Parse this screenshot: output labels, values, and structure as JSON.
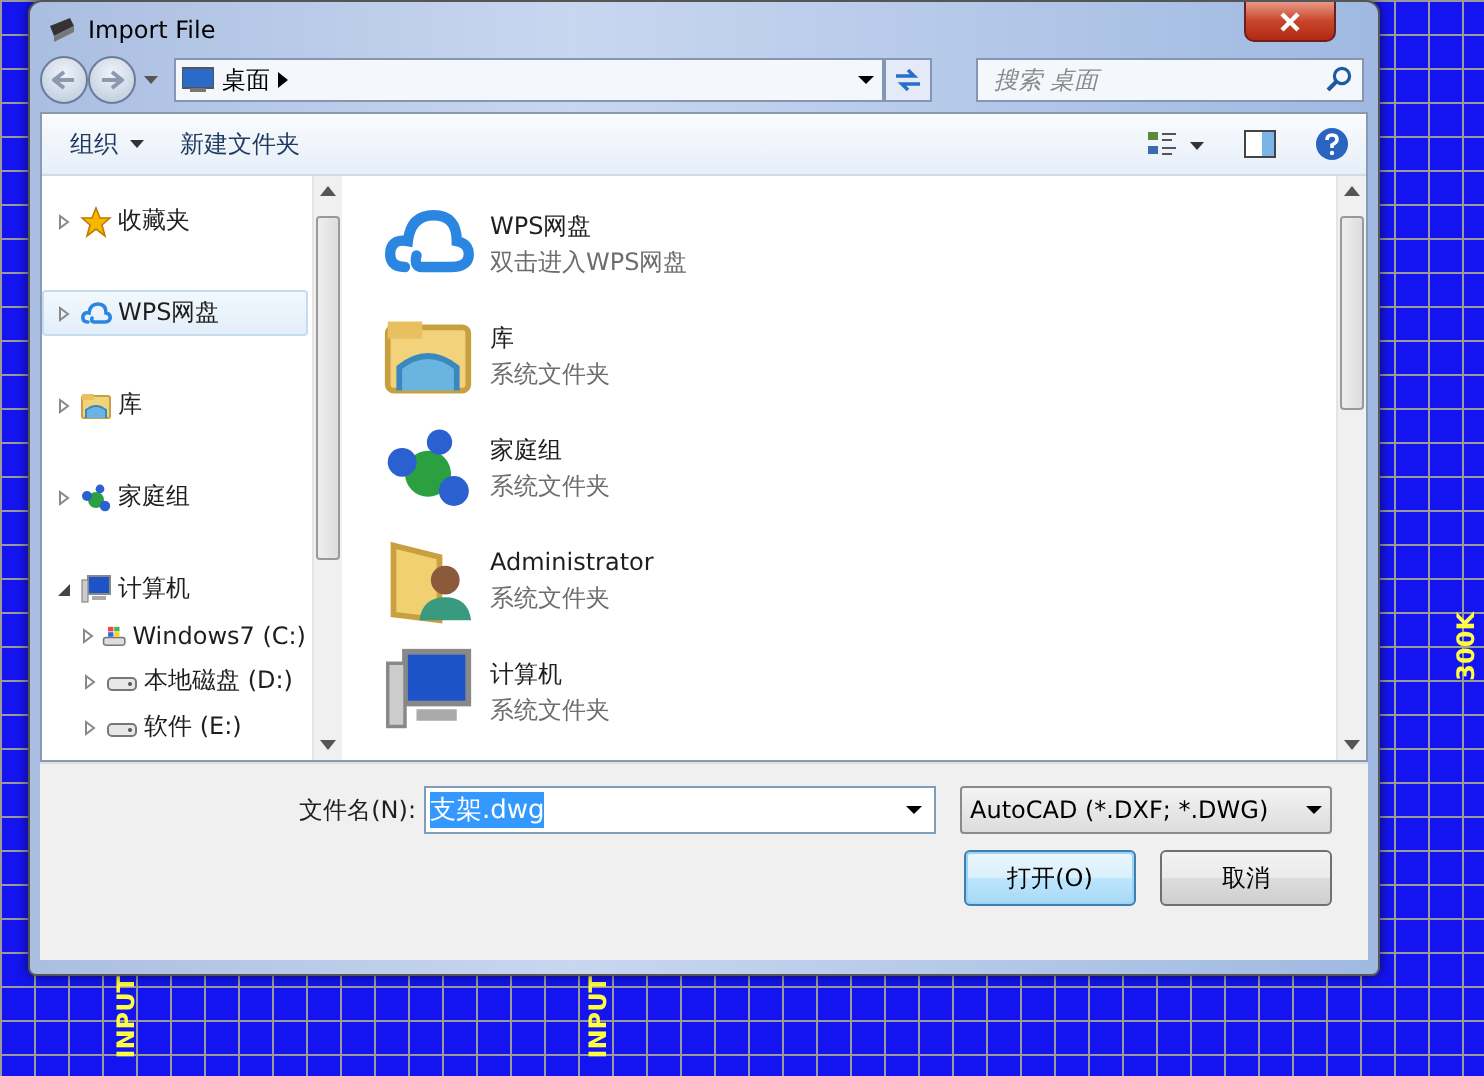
{
  "background": {
    "labels": [
      {
        "text": "INPUT"
      },
      {
        "text": "INPUT"
      },
      {
        "text": "300K"
      }
    ]
  },
  "window": {
    "title": "Import File"
  },
  "address": {
    "path": "桌面",
    "search_placeholder": "搜索 桌面"
  },
  "toolbar": {
    "organize": "组织",
    "new_folder": "新建文件夹"
  },
  "nav": [
    {
      "label": "收藏夹",
      "kind": "star",
      "selected": false,
      "expanded": false
    },
    {
      "label": "WPS网盘",
      "kind": "cloud",
      "selected": true,
      "expanded": false
    },
    {
      "label": "库",
      "kind": "library",
      "selected": false,
      "expanded": false
    },
    {
      "label": "家庭组",
      "kind": "homegroup",
      "selected": false,
      "expanded": false
    },
    {
      "label": "计算机",
      "kind": "computer",
      "selected": false,
      "expanded": true,
      "children": [
        {
          "label": "Windows7 (C:)",
          "kind": "system",
          "selected": false,
          "expanded": false
        },
        {
          "label": "本地磁盘 (D:)",
          "kind": "drive",
          "selected": false,
          "expanded": false
        },
        {
          "label": "软件 (E:)",
          "kind": "drive",
          "selected": false,
          "expanded": false
        }
      ]
    }
  ],
  "files": [
    {
      "name": "WPS网盘",
      "description": "双击进入WPS网盘",
      "kind": "cloud"
    },
    {
      "name": "库",
      "description": "系统文件夹",
      "kind": "library"
    },
    {
      "name": "家庭组",
      "description": "系统文件夹",
      "kind": "homegroup"
    },
    {
      "name": "Administrator",
      "description": "系统文件夹",
      "kind": "user"
    },
    {
      "name": "计算机",
      "description": "系统文件夹",
      "kind": "computer"
    }
  ],
  "filename": {
    "label": "文件名(N):",
    "value": "支架.dwg"
  },
  "file_type": "AutoCAD (*.DXF; *.DWG)",
  "buttons": [
    {
      "label": "打开(O)",
      "kind": "default"
    },
    {
      "label": "取消",
      "kind": "normal"
    }
  ]
}
